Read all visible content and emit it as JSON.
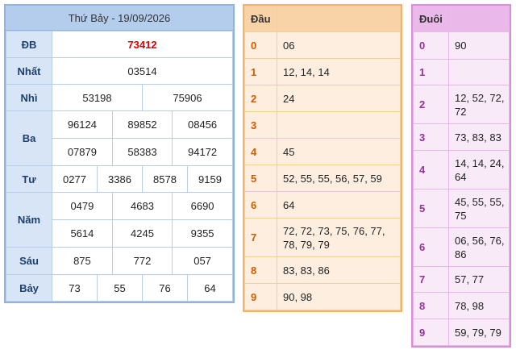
{
  "main": {
    "title": "Thứ Bảy - 19/09/2026",
    "rows": [
      {
        "label": "ĐB",
        "values": [
          "73412"
        ]
      },
      {
        "label": "Nhất",
        "values": [
          "03514"
        ]
      },
      {
        "label": "Nhì",
        "values": [
          "53198",
          "75906"
        ]
      },
      {
        "label": "Ba",
        "values": [
          "96124",
          "89852",
          "08456",
          "07879",
          "58383",
          "94172"
        ]
      },
      {
        "label": "Tư",
        "values": [
          "0277",
          "3386",
          "8578",
          "9159"
        ]
      },
      {
        "label": "Năm",
        "values": [
          "0479",
          "4683",
          "6690",
          "5614",
          "4245",
          "9355"
        ]
      },
      {
        "label": "Sáu",
        "values": [
          "875",
          "772",
          "057"
        ]
      },
      {
        "label": "Bảy",
        "values": [
          "73",
          "55",
          "76",
          "64"
        ]
      }
    ],
    "special_color": "#e00000"
  },
  "dau": {
    "header_key": "Đầu",
    "header_val": "",
    "rows": [
      {
        "k": "0",
        "v": "06"
      },
      {
        "k": "1",
        "v": "12, 14, 14"
      },
      {
        "k": "2",
        "v": "24"
      },
      {
        "k": "3",
        "v": ""
      },
      {
        "k": "4",
        "v": "45"
      },
      {
        "k": "5",
        "v": "52, 55, 55, 56, 57, 59"
      },
      {
        "k": "6",
        "v": "64"
      },
      {
        "k": "7",
        "v": "72, 72, 73, 75, 76, 77, 78, 79, 79"
      },
      {
        "k": "8",
        "v": "83, 83, 86"
      },
      {
        "k": "9",
        "v": "90, 98"
      }
    ]
  },
  "duoi": {
    "header_key": "Đuôi",
    "header_val": "",
    "rows": [
      {
        "k": "0",
        "v": "90"
      },
      {
        "k": "1",
        "v": ""
      },
      {
        "k": "2",
        "v": "12, 52, 72, 72"
      },
      {
        "k": "3",
        "v": "73, 83, 83"
      },
      {
        "k": "4",
        "v": "14, 14, 24, 64"
      },
      {
        "k": "5",
        "v": "45, 55, 55, 75"
      },
      {
        "k": "6",
        "v": "06, 56, 76, 86"
      },
      {
        "k": "7",
        "v": "57, 77"
      },
      {
        "k": "8",
        "v": "78, 98"
      },
      {
        "k": "9",
        "v": "59, 79, 79"
      }
    ]
  }
}
